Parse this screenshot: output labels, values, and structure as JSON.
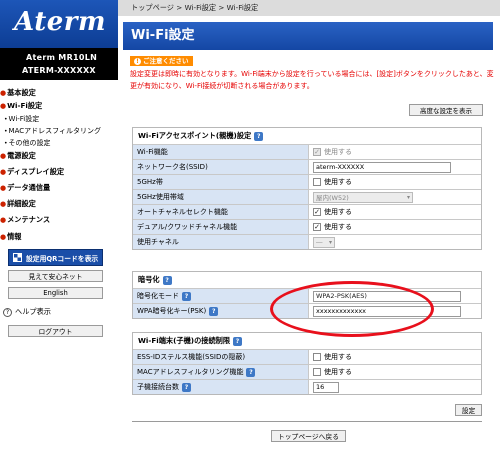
{
  "sidebar": {
    "logo": "Aterm",
    "model_name": "Aterm MR10LN",
    "device_name": "ATERM-XXXXXX",
    "nav": [
      {
        "label": "基本設定"
      },
      {
        "label": "Wi-Fi設定"
      },
      {
        "label": "電源設定"
      },
      {
        "label": "ディスプレイ設定"
      },
      {
        "label": "データ通信量"
      },
      {
        "label": "詳細設定"
      },
      {
        "label": "メンテナンス"
      },
      {
        "label": "情報"
      }
    ],
    "wifi_sub": [
      {
        "label": "Wi-Fi設定"
      },
      {
        "label": "MACアドレスフィルタリング"
      },
      {
        "label": "その他の設定"
      }
    ],
    "qr_button": "設定用QRコードを表示",
    "mimamori_button": "見えて安心ネット",
    "english_button": "English",
    "help_label": "ヘルプ表示",
    "logout_button": "ログアウト"
  },
  "main": {
    "breadcrumb": "トップページ > Wi-Fi設定 > Wi-Fi設定",
    "page_title": "Wi-Fi設定",
    "notice_badge": "ご注意ください",
    "notice_text": "設定変更は即時に有効となります。Wi-Fi端末から設定を行っている場合には、[設定]ボタンをクリックしたあと、変更が有効になり、Wi-Fi接続が切断される場合があります。",
    "advanced_button": "高度な設定を表示",
    "help_glyph": "?",
    "ap_section": {
      "title": "Wi-Fiアクセスポイント(親機)設定",
      "wifi_function_label": "Wi-Fi機能",
      "wifi_function_value": "使用する",
      "ssid_label": "ネットワーク名(SSID)",
      "ssid_value": "aterm-XXXXXX",
      "band_5ghz_label": "5GHz帯",
      "band_5ghz_value": "使用する",
      "band_5ghz_range_label": "5GHz使用帯域",
      "band_5ghz_range_value": "屋内(W52)",
      "auto_channel_label": "オートチャネルセレクト機能",
      "auto_channel_value": "使用する",
      "dual_channel_label": "デュアル/クワッドチャネル機能",
      "dual_channel_value": "使用する",
      "channel_label": "使用チャネル",
      "channel_value": "―"
    },
    "encryption_section": {
      "title": "暗号化",
      "mode_label": "暗号化モード",
      "mode_value": "WPA2-PSK(AES)",
      "key_label": "WPA暗号化キー(PSK)",
      "key_value": "xxxxxxxxxxxxx"
    },
    "restriction_section": {
      "title": "Wi-Fi端末(子機)の接続制限",
      "essid_stealth_label": "ESS-IDステルス機能(SSIDの隠蔽)",
      "essid_stealth_value": "使用する",
      "mac_filter_label": "MACアドレスフィルタリング機能",
      "mac_filter_value": "使用する",
      "client_count_label": "子機接続台数",
      "client_count_value": "16"
    },
    "settings_button": "設定",
    "back_button": "トップページへ戻る"
  },
  "colors": {
    "brand_blue": "#1447a4",
    "row_label_bg": "#d8e4f4",
    "notice_red": "#e60000",
    "notice_badge_orange": "#ff8c00",
    "highlight_ellipse": "#e8101c"
  },
  "state": {
    "wifi_function_checked": true,
    "wifi_function_disabled": true,
    "band_5ghz_checked": false,
    "auto_channel_checked": true,
    "dual_channel_checked": true,
    "essid_stealth_checked": false,
    "mac_filter_checked": false
  }
}
